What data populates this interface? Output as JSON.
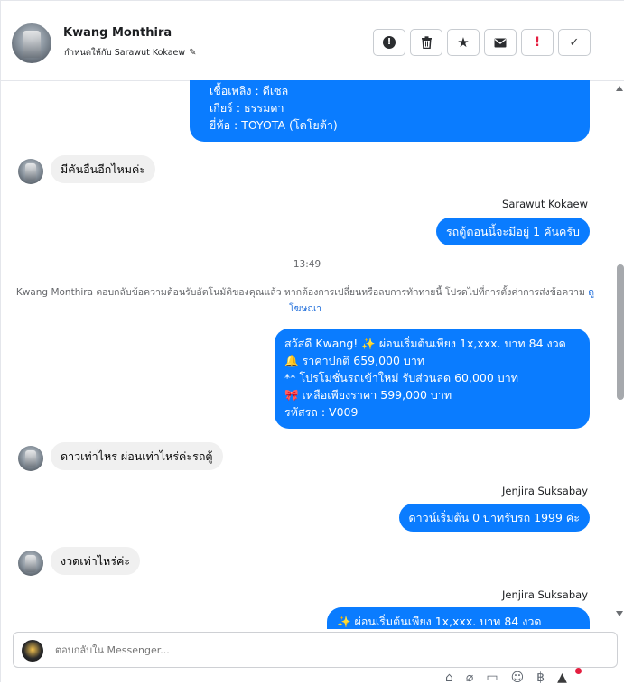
{
  "header": {
    "name": "Kwang Monthira",
    "assigned": "กำหนดให้กับ Sarawut Kokaew",
    "toolbar": [
      {
        "name": "info-button",
        "icon": "alert-icon"
      },
      {
        "name": "delete-button",
        "icon": "trash-icon"
      },
      {
        "name": "star-button",
        "icon": "star-icon"
      },
      {
        "name": "mail-button",
        "icon": "envelope-icon"
      },
      {
        "name": "spam-button",
        "icon": "exclamation-icon"
      },
      {
        "name": "done-button",
        "icon": "check-icon"
      }
    ]
  },
  "messages": {
    "top_bubble": [
      "เชื้อเพลิง : ดีเซล",
      "เกียร์ : ธรรมดา",
      "ยี่ห้อ : TOYOTA (โตโยต้า)"
    ],
    "in1": "มีคันอื่นอีกไหมค่ะ",
    "sender1": "Sarawut Kokaew",
    "out1": "รถตู้ตอนนี้จะมีอยู่ 1 คันครับ",
    "time": "13:49",
    "notice": "Kwang Monthira ตอบกลับข้อความต้อนรับอัตโนมัติของคุณแล้ว หากต้องการเปลี่ยนหรือลบการทักทายนี้ โปรดไปที่การตั้งค่าการส่งข้อความ",
    "notice_link": "ดูโฆษณา",
    "promo": [
      "สวัสดี Kwang! ✨  ผ่อนเริ่มต้นเพียง 1x,xxx. บาท 84 งวด",
      "🔔 ราคาปกติ 659,000 บาท",
      "** โปรโมชั่นรถเข้าใหม่ รับส่วนลด 60,000 บาท",
      "🎀  เหลือเพียงราคา 599,000 บาท",
      " รหัสรถ : V009"
    ],
    "in2": "ดาวเท่าไหร่ ผ่อนเท่าไหร่ค่ะรถตู้",
    "sender2": "Jenjira Suksabay",
    "out2": "ดาวน์เริ่มต้น 0 บาทรับรถ 1999 ค่ะ",
    "in3": "งวดเท่าไหร่ค่ะ",
    "sender3": "Jenjira Suksabay",
    "partial": "✨  ผ่อนเริ่มต้นเพียง 1x,xxx. บาท 84 งวด"
  },
  "composer": {
    "placeholder": "ตอบกลับใน Messenger..."
  },
  "colors": {
    "outgoing": "#0a7cff",
    "incoming": "#f0f0f0",
    "accent_red": "#e41e3f"
  }
}
